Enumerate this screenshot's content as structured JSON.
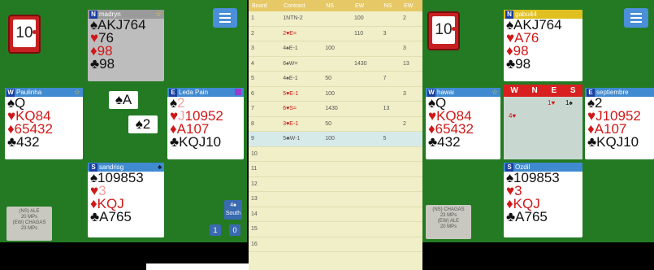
{
  "left": {
    "tricks": "10",
    "north": {
      "seat": "N",
      "name": "madryn",
      "spades": "♠AKJ764",
      "hearts_shown": "♥",
      "hearts": "76",
      "diamonds": "♦98",
      "clubs": "♣98"
    },
    "west": {
      "seat": "W",
      "name": "Paulinha",
      "spades": "♠Q",
      "hearts": "♥KQ84",
      "diamonds": "♦65432",
      "clubs": "♣432"
    },
    "east": {
      "seat": "E",
      "name": "Leda Pain",
      "spades_sym": "♠",
      "spades": "2",
      "hearts_sym": "♥",
      "hearts_faded": "J",
      "hearts": "10952",
      "diamonds": "♦A107",
      "clubs": "♣KQJ10"
    },
    "south": {
      "seat": "S",
      "name": "sandrisg",
      "spades": "♠109853",
      "hearts_sym": "♥",
      "hearts": "3",
      "diamonds": "♦KQJ",
      "clubs": "♣A765"
    },
    "played": {
      "north": "♠A",
      "east": "♠2"
    },
    "info": [
      "(NS) ALE",
      "20 MPs",
      "(EW) CHAGAS",
      "23 MPs"
    ],
    "dummy": "4♠",
    "dummy_sub": "South",
    "score_ns": "1",
    "score_ew": "0"
  },
  "mid": {
    "headers": [
      "Board",
      "Contract",
      "NS",
      "EW",
      "NS",
      "EW"
    ],
    "rows": [
      [
        "1",
        "1NTN-2",
        "",
        "100",
        "",
        "2"
      ],
      [
        "2",
        "2♥E=",
        "",
        "110",
        "3",
        ""
      ],
      [
        "3",
        "4♠E-1",
        "100",
        "",
        "",
        "3"
      ],
      [
        "4",
        "6♠W=",
        "",
        "1430",
        "",
        "13"
      ],
      [
        "5",
        "4♠E-1",
        "50",
        "",
        "7",
        ""
      ],
      [
        "6",
        "5♥E-1",
        "100",
        "",
        "",
        "3"
      ],
      [
        "7",
        "6♥S=",
        "1430",
        "",
        "13",
        ""
      ],
      [
        "8",
        "3♥E-1",
        "50",
        "",
        "",
        "2"
      ],
      [
        "9",
        "5♣W-1",
        "100",
        "",
        "5",
        ""
      ],
      [
        "10",
        "",
        "",
        "",
        "",
        ""
      ],
      [
        "11",
        "",
        "",
        "",
        "",
        ""
      ],
      [
        "12",
        "",
        "",
        "",
        "",
        ""
      ],
      [
        "13",
        "",
        "",
        "",
        "",
        ""
      ],
      [
        "14",
        "",
        "",
        "",
        "",
        ""
      ],
      [
        "15",
        "",
        "",
        "",
        "",
        ""
      ],
      [
        "16",
        "",
        "",
        "",
        "",
        ""
      ]
    ]
  },
  "right": {
    "tricks": "10",
    "north": {
      "seat": "N",
      "name": "gabu44",
      "spades": "♠AKJ764",
      "hearts": "♥A76",
      "diamonds": "♦98",
      "clubs": "♣98"
    },
    "west": {
      "seat": "W",
      "name": "hawai",
      "spades": "♠Q",
      "hearts": "♥KQ84",
      "diamonds": "♦65432",
      "clubs": "♣432"
    },
    "east": {
      "seat": "E",
      "name": "septiembre",
      "spades": "♠2",
      "hearts": "♥J10952",
      "diamonds": "♦A107",
      "clubs": "♣KQJ10"
    },
    "south": {
      "seat": "S",
      "name": "Ozdil",
      "spades": "♠109853",
      "hearts": "♥3",
      "diamonds": "♦KQJ",
      "clubs": "♣A765"
    },
    "bidding": {
      "cols": [
        "W",
        "N",
        "E",
        "S"
      ],
      "r1": "1♥",
      "r1b": "1♠",
      "r2": "4♥"
    },
    "info": [
      "(NS) CHAGAS",
      "23 MPs",
      "(EW) ALE",
      "20 MPs"
    ]
  }
}
